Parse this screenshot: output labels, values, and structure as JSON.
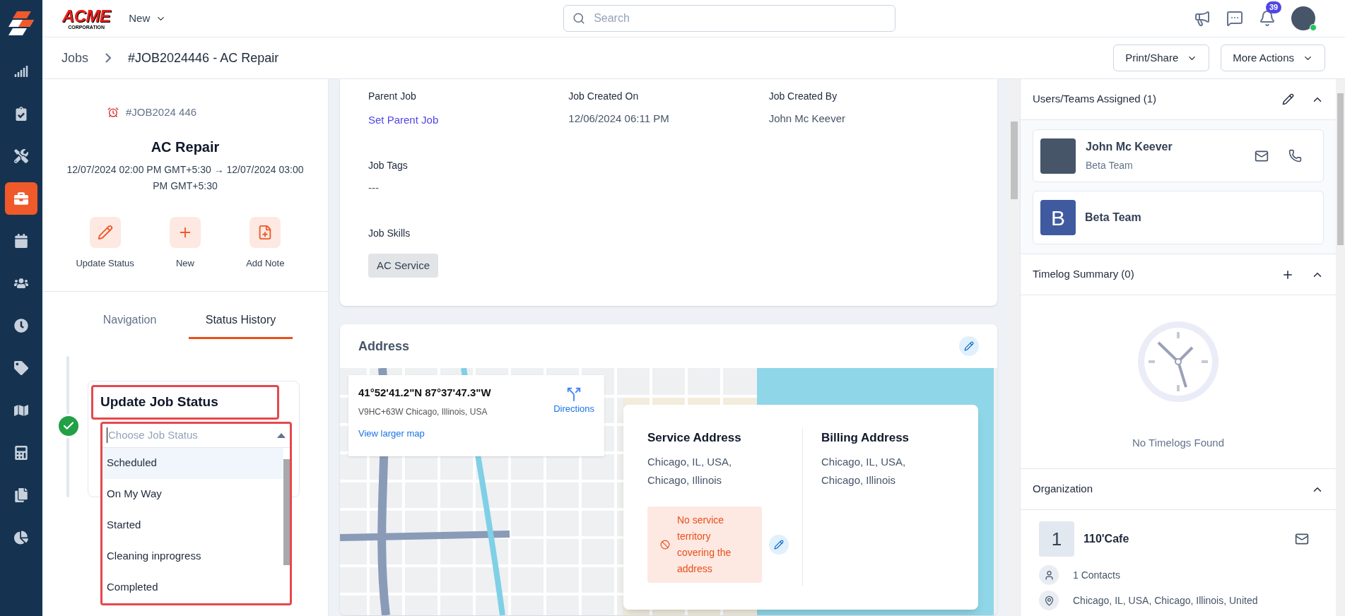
{
  "sidebar": {
    "items": [
      {
        "kind": "chart",
        "selected": false
      },
      {
        "kind": "clipboard",
        "selected": false
      },
      {
        "kind": "tools",
        "selected": false
      },
      {
        "kind": "briefcase",
        "selected": true
      },
      {
        "kind": "calendar",
        "selected": false
      },
      {
        "kind": "users",
        "selected": false
      },
      {
        "kind": "clock",
        "selected": false
      },
      {
        "kind": "tag",
        "selected": false
      },
      {
        "kind": "map",
        "selected": false
      },
      {
        "kind": "calculator",
        "selected": false
      },
      {
        "kind": "files",
        "selected": false
      },
      {
        "kind": "pie",
        "selected": false
      }
    ]
  },
  "topbar": {
    "logo": {
      "name": "ACME",
      "tagline": "CORPORATION"
    },
    "new_menu": "New",
    "search": {
      "placeholder": "Search"
    },
    "notifications_count": "39",
    "user_online": true
  },
  "breadcrumb": {
    "parent": "Jobs",
    "current": "#JOB2024446 - AC Repair"
  },
  "header_buttons": [
    "Print/Share",
    "More Actions"
  ],
  "job": {
    "id": "#JOB2024 446",
    "title": "AC Repair",
    "schedule": "12/07/2024 02:00 PM GMT+5:30 → 12/07/2024 03:00 PM GMT+5:30",
    "actions": [
      {
        "kind": "edit",
        "label": "Update Status"
      },
      {
        "kind": "add",
        "label": "New"
      },
      {
        "kind": "note",
        "label": "Add Note"
      }
    ]
  },
  "tabs": [
    {
      "label": "Navigation",
      "selected": false
    },
    {
      "label": "Status History",
      "selected": true
    }
  ],
  "status_update": {
    "title": "Update Job Status",
    "done": true,
    "placeholder": "Choose Job Status",
    "options": [
      {
        "label": "Scheduled",
        "selected": true
      },
      {
        "label": "On My Way",
        "selected": false
      },
      {
        "label": "Started",
        "selected": false
      },
      {
        "label": "Cleaning inprogress",
        "selected": false
      },
      {
        "label": "Completed",
        "selected": false
      }
    ]
  },
  "details": {
    "fields": [
      {
        "label": "Parent Job",
        "value": "Set Parent Job",
        "kind": "link"
      },
      {
        "label": "Job Created On",
        "value": "12/06/2024 06:11 PM",
        "kind": "text"
      },
      {
        "label": "Job Created By",
        "value": "John Mc Keever",
        "kind": "text"
      },
      {
        "label": "Job Tags",
        "value": "---",
        "kind": "text"
      },
      {
        "label": "Job Skills",
        "value": "AC Service",
        "kind": "chip"
      }
    ]
  },
  "address": {
    "title": "Address",
    "map_info": {
      "coordinates": "41°52'41.2\"N 87°37'47.3\"W",
      "plus_code": "V9HC+63W Chicago, Illinois, USA",
      "directions": "Directions",
      "larger_map": "View larger map"
    },
    "service": {
      "title": "Service Address",
      "lines": [
        "Chicago, IL, USA,",
        "Chicago, Illinois"
      ],
      "warning": "No service territory covering the address"
    },
    "billing": {
      "title": "Billing Address",
      "lines": [
        "Chicago, IL, USA,",
        "Chicago, Illinois"
      ]
    }
  },
  "assigned": {
    "title": "Users/Teams Assigned (1)",
    "members": [
      {
        "kind": "user",
        "name": "John Mc Keever",
        "team": "Beta Team"
      },
      {
        "kind": "team",
        "initial": "B",
        "name": "Beta Team"
      }
    ]
  },
  "timelog": {
    "title": "Timelog Summary (0)",
    "empty": "No Timelogs Found"
  },
  "organization": {
    "title": "Organization",
    "initial": "1",
    "name": "110'Cafe",
    "contacts": "1 Contacts",
    "address": "Chicago, IL, USA, Chicago, Illinois, United"
  }
}
